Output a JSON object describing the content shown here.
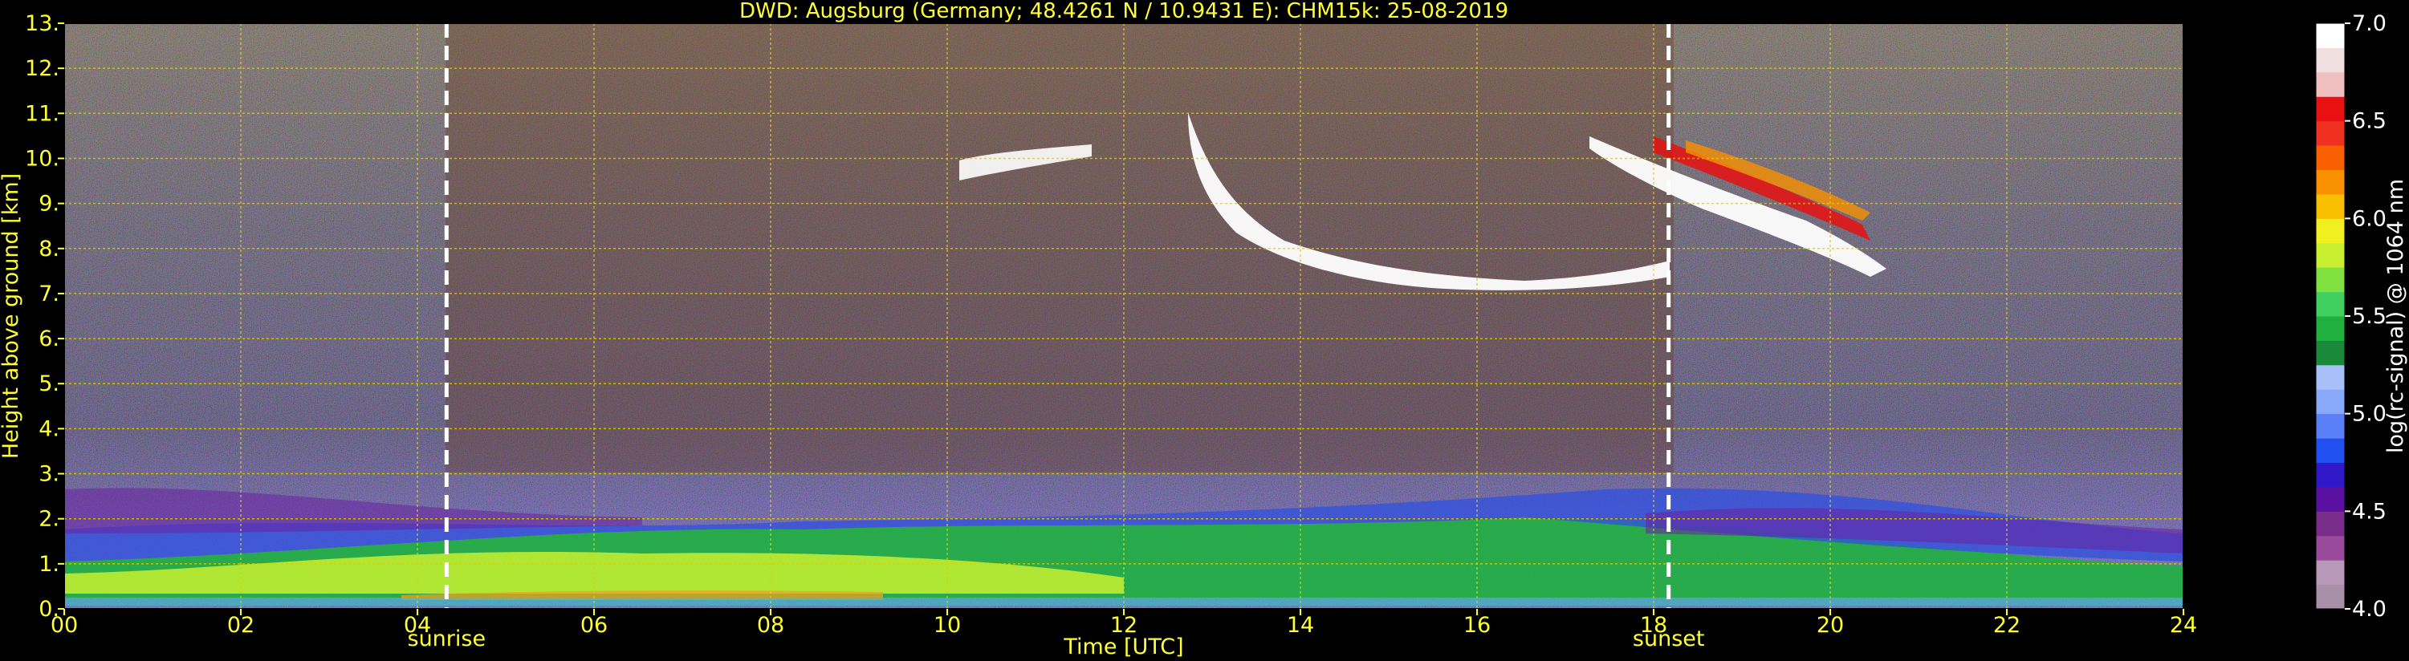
{
  "chart_data": {
    "type": "heatmap",
    "title": "DWD: Augsburg (Germany; 48.4261 N / 10.9431 E):    CHM15k: 25-08-2019",
    "xlabel": "Time [UTC]",
    "ylabel": "Height above ground [km]",
    "xlim": [
      0,
      24
    ],
    "ylim": [
      0,
      13
    ],
    "x_ticks": [
      "00",
      "02",
      "04",
      "06",
      "08",
      "10",
      "12",
      "14",
      "16",
      "18",
      "20",
      "22",
      "24"
    ],
    "y_ticks": [
      "0.",
      "1.",
      "2.",
      "3.",
      "4.",
      "5.",
      "6.",
      "7.",
      "8.",
      "9.",
      "10.",
      "11.",
      "12.",
      "13."
    ],
    "grid": true,
    "events": [
      {
        "label": "sunrise",
        "x": 4.33
      },
      {
        "label": "sunset",
        "x": 18.17
      }
    ],
    "colorbar": {
      "label": "log(rc-signal) @ 1064 nm",
      "range": [
        4.0,
        7.0
      ],
      "ticks": [
        "4.0",
        "4.5",
        "5.0",
        "5.5",
        "6.0",
        "6.5",
        "7.0"
      ],
      "colors": [
        "#a890a8",
        "#b898b8",
        "#9a4a9a",
        "#7a2c8a",
        "#5a10a0",
        "#3018c8",
        "#2050f0",
        "#5a80f8",
        "#8aa8f8",
        "#a8c0f8",
        "#1a8a3a",
        "#20b040",
        "#40d060",
        "#80e040",
        "#c8f030",
        "#f0f020",
        "#f8c000",
        "#f89000",
        "#f86000",
        "#f03020",
        "#e81010",
        "#f0c0c0",
        "#f0e0e0",
        "#ffffff"
      ]
    }
  }
}
